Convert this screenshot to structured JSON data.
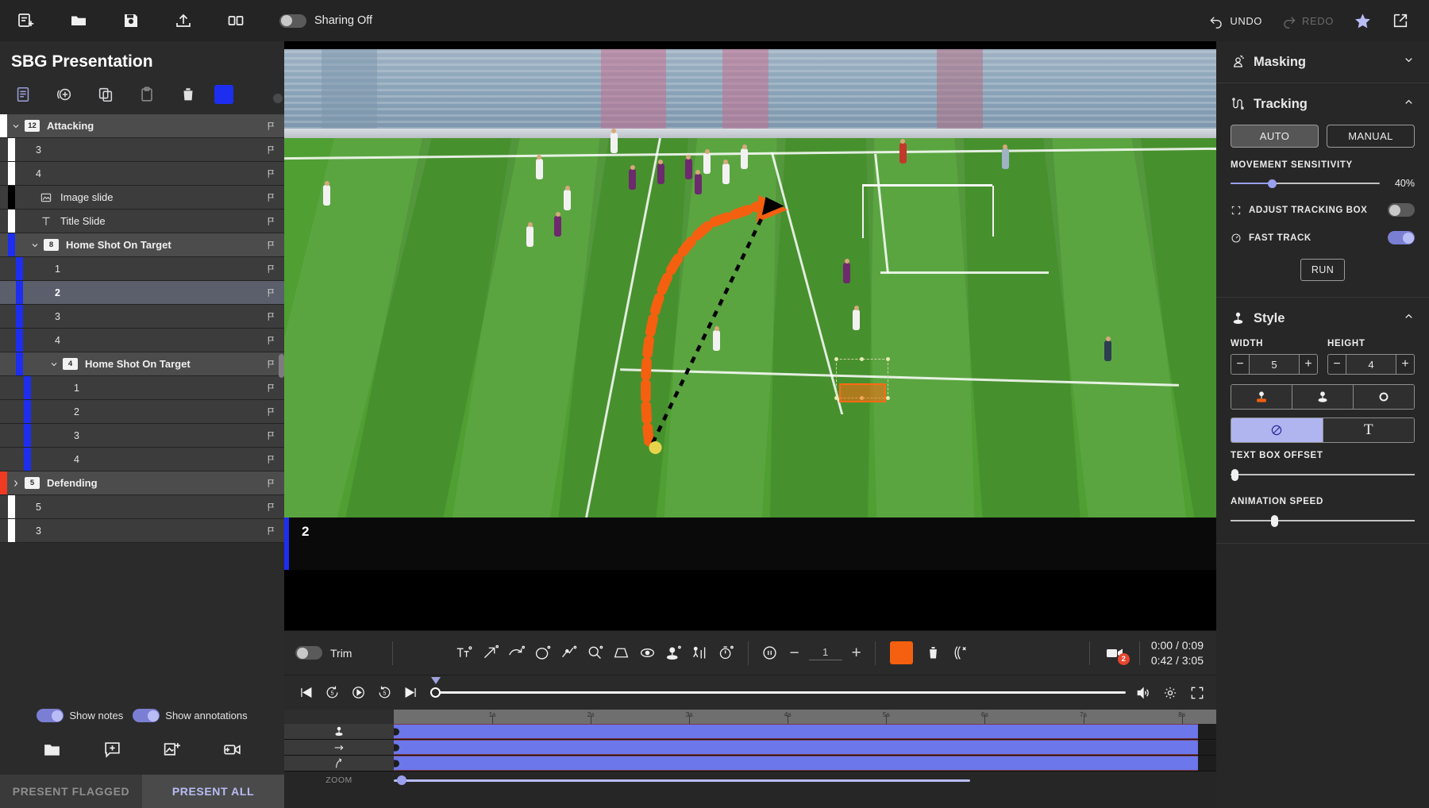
{
  "topbar": {
    "icons": [
      "new-slide-icon",
      "folder-open-icon",
      "save-icon",
      "upload-icon",
      "split-view-icon"
    ],
    "sharing_label": "Sharing Off",
    "sharing_on": false,
    "undo_label": "UNDO",
    "redo_label": "REDO"
  },
  "sidebar": {
    "title": "SBG Presentation",
    "tools": [
      "document-icon",
      "add-circle-icon",
      "copy-icon",
      "paste-icon",
      "trash-icon"
    ],
    "color_chip": "#1d2ef0",
    "tree": [
      {
        "type": "group",
        "label": "Attacking",
        "count": "12",
        "bar": "#ffffff",
        "depth": 0,
        "expanded": true,
        "selected": false
      },
      {
        "type": "item",
        "label": "3",
        "bar": "#ffffff",
        "depth": 1,
        "selected": false
      },
      {
        "type": "item",
        "label": "4",
        "bar": "#ffffff",
        "depth": 1,
        "selected": false
      },
      {
        "type": "icon",
        "label": "Image slide",
        "icon": "image-icon",
        "bar": "#000000",
        "depth": 1,
        "selected": false
      },
      {
        "type": "icon",
        "label": "Title Slide",
        "icon": "text-icon",
        "bar": "#ffffff",
        "depth": 1,
        "selected": false
      },
      {
        "type": "group",
        "label": "Home Shot On Target",
        "count": "8",
        "bar": "#1d2ef0",
        "depth": 1,
        "expanded": true,
        "selected": false
      },
      {
        "type": "item",
        "label": "1",
        "bar": "#1d2ef0",
        "depth": 2,
        "selected": false
      },
      {
        "type": "item",
        "label": "2",
        "bar": "#1d2ef0",
        "depth": 2,
        "selected": true
      },
      {
        "type": "item",
        "label": "3",
        "bar": "#1d2ef0",
        "depth": 2,
        "selected": false
      },
      {
        "type": "item",
        "label": "4",
        "bar": "#1d2ef0",
        "depth": 2,
        "selected": false
      },
      {
        "type": "group",
        "label": "Home Shot On Target",
        "count": "4",
        "bar": "#1d2ef0",
        "depth": 2,
        "expanded": true,
        "selected": false
      },
      {
        "type": "item",
        "label": "1",
        "bar": "#1d2ef0",
        "depth": 3,
        "selected": false
      },
      {
        "type": "item",
        "label": "2",
        "bar": "#1d2ef0",
        "depth": 3,
        "selected": false
      },
      {
        "type": "item",
        "label": "3",
        "bar": "#1d2ef0",
        "depth": 3,
        "selected": false
      },
      {
        "type": "item",
        "label": "4",
        "bar": "#1d2ef0",
        "depth": 3,
        "selected": false
      },
      {
        "type": "group",
        "label": "Defending",
        "count": "5",
        "bar": "#ef3b22",
        "depth": 0,
        "expanded": false,
        "selected": false
      },
      {
        "type": "item",
        "label": "5",
        "bar": "#ffffff",
        "depth": 1,
        "selected": false
      },
      {
        "type": "item",
        "label": "3",
        "bar": "#ffffff",
        "depth": 1,
        "selected": false
      }
    ],
    "show_notes_label": "Show notes",
    "show_notes_on": true,
    "show_annotations_label": "Show annotations",
    "show_annotations_on": true,
    "bottom_icons": [
      "folder-icon",
      "add-note-icon",
      "add-image-icon",
      "add-video-icon"
    ],
    "present_flagged_label": "PRESENT FLAGGED",
    "present_all_label": "PRESENT ALL"
  },
  "stage": {
    "slide_number": "2",
    "tracking_box_color": "#ff6a12"
  },
  "toolbar": {
    "trim_label": "Trim",
    "trim_on": false,
    "tools": [
      "text-tool-icon",
      "arrow-tool-icon",
      "curved-arrow-icon",
      "circle-tool-icon",
      "freehand-tool-icon",
      "magnify-tool-icon",
      "trapezoid-tool-icon",
      "eye-tool-icon",
      "spotlight-tool-icon",
      "player-measure-icon",
      "timer-tool-icon"
    ],
    "pause_icon": "pause-icon",
    "stepper_value": "1",
    "swatch_color": "#f4600f",
    "delete_icon": "trash-icon",
    "clear_icon": "clear-annotations-icon",
    "camera_icon": "camera-icon",
    "camera_badge": "2",
    "time_clip": "0:00 / 0:09",
    "time_total": "0:42 / 3:05"
  },
  "transport": {
    "buttons": [
      "skip-start-icon",
      "rewind-5-icon",
      "play-icon",
      "forward-5-icon",
      "skip-end-icon"
    ],
    "right_buttons": [
      "volume-icon",
      "settings-icon",
      "fullscreen-icon"
    ]
  },
  "timeline": {
    "ruler_labels": [
      "1s",
      "2s",
      "3s",
      "4s",
      "5s",
      "6s",
      "7s",
      "8s"
    ],
    "tracks": [
      {
        "icon": "spotlight-track-icon"
      },
      {
        "icon": "arrow-track-icon"
      },
      {
        "icon": "curve-track-icon"
      }
    ],
    "zoom_label": "ZOOM"
  },
  "right_panel": {
    "masking": {
      "title": "Masking",
      "icon": "masking-icon",
      "expanded": false
    },
    "tracking": {
      "title": "Tracking",
      "icon": "tracking-icon",
      "expanded": true,
      "auto_label": "AUTO",
      "manual_label": "MANUAL",
      "mode": "AUTO",
      "sensitivity_label": "MOVEMENT SENSITIVITY",
      "sensitivity_value": "40%",
      "sensitivity_pct": 28,
      "adjust_box_label": "ADJUST TRACKING BOX",
      "adjust_box_on": false,
      "fast_track_label": "FAST TRACK",
      "fast_track_on": true,
      "run_label": "RUN"
    },
    "style": {
      "title": "Style",
      "icon": "style-icon",
      "expanded": true,
      "width_label": "WIDTH",
      "width_value": "5",
      "height_label": "HEIGHT",
      "height_value": "4",
      "shape_buttons": [
        "filled-marker-icon",
        "outline-marker-icon",
        "ring-icon"
      ],
      "shape_selected": 0,
      "label_buttons": [
        "no-label-icon",
        "text-label-icon"
      ],
      "label_selected": 0,
      "text_offset_label": "TEXT BOX OFFSET",
      "text_offset_pct": 1,
      "animation_speed_label": "ANIMATION SPEED",
      "animation_speed_pct": 24
    }
  }
}
